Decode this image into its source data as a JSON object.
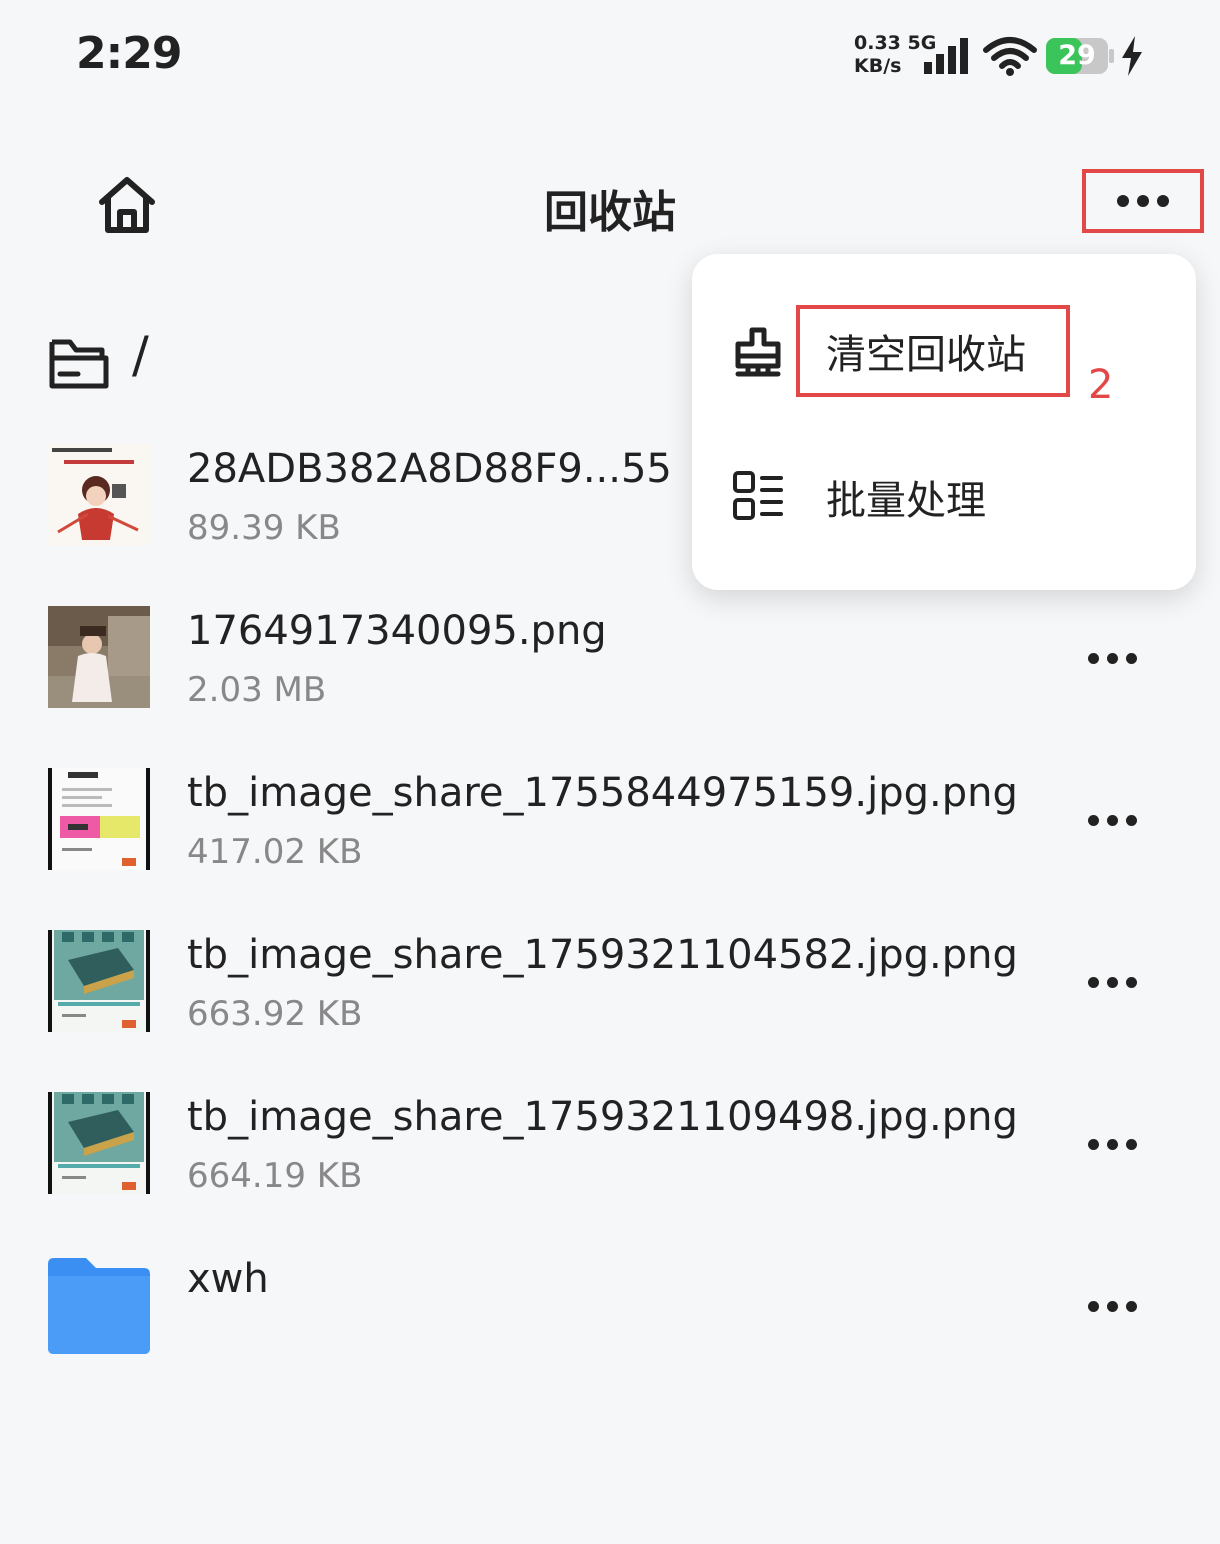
{
  "status_bar": {
    "time": "2:29",
    "net_speed": "0.33",
    "net_unit": "KB/s",
    "network": "5G",
    "battery": "29",
    "battery_color": "#3bc45a"
  },
  "header": {
    "title": "回收站",
    "home_icon": "home-icon",
    "more_icon": "more-dots-icon"
  },
  "path": {
    "text": "/",
    "icon": "folder-outline-icon"
  },
  "files": [
    {
      "name": "28ADB382A8D88F9...55",
      "size": "89.39 KB"
    },
    {
      "name": "1764917340095.png",
      "size": "2.03 MB"
    },
    {
      "name": "tb_image_share_1755844975159.jpg.png",
      "size": "417.02 KB"
    },
    {
      "name": "tb_image_share_1759321104582.jpg.png",
      "size": "663.92 KB"
    },
    {
      "name": "tb_image_share_1759321109498.jpg.png",
      "size": "664.19 KB"
    },
    {
      "name": "xwh",
      "size": ""
    }
  ],
  "menu": {
    "items": [
      {
        "label": "清空回收站",
        "icon": "broom-icon"
      },
      {
        "label": "批量处理",
        "icon": "list-icon"
      }
    ],
    "annotation": "2",
    "highlight_color": "#e24848"
  },
  "folder_color": "#3b8ff2"
}
